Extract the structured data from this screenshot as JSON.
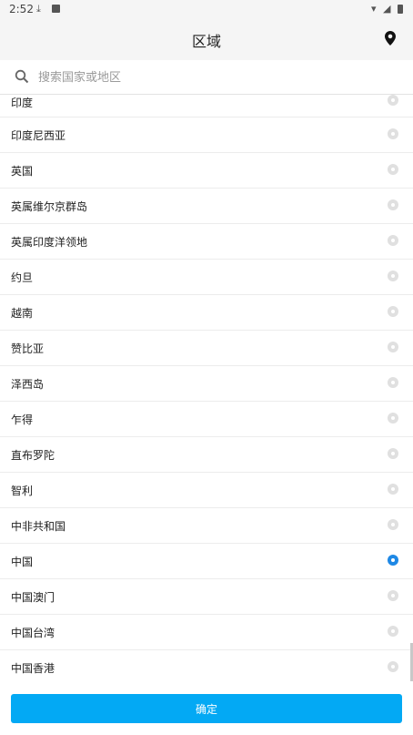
{
  "status": {
    "time": "2:52"
  },
  "header": {
    "title": "区域"
  },
  "search": {
    "placeholder": "搜索国家或地区"
  },
  "regions": [
    {
      "label": "印度",
      "selected": false
    },
    {
      "label": "印度尼西亚",
      "selected": false
    },
    {
      "label": "英国",
      "selected": false
    },
    {
      "label": "英属维尔京群岛",
      "selected": false
    },
    {
      "label": "英属印度洋领地",
      "selected": false
    },
    {
      "label": "约旦",
      "selected": false
    },
    {
      "label": "越南",
      "selected": false
    },
    {
      "label": "赞比亚",
      "selected": false
    },
    {
      "label": "泽西岛",
      "selected": false
    },
    {
      "label": "乍得",
      "selected": false
    },
    {
      "label": "直布罗陀",
      "selected": false
    },
    {
      "label": "智利",
      "selected": false
    },
    {
      "label": "中非共和国",
      "selected": false
    },
    {
      "label": "中国",
      "selected": true
    },
    {
      "label": "中国澳门",
      "selected": false
    },
    {
      "label": "中国台湾",
      "selected": false
    },
    {
      "label": "中国香港",
      "selected": false
    }
  ],
  "footer": {
    "confirm_label": "确定"
  },
  "colors": {
    "accent": "#03a9f4",
    "selected_radio": "#1e88e5"
  }
}
